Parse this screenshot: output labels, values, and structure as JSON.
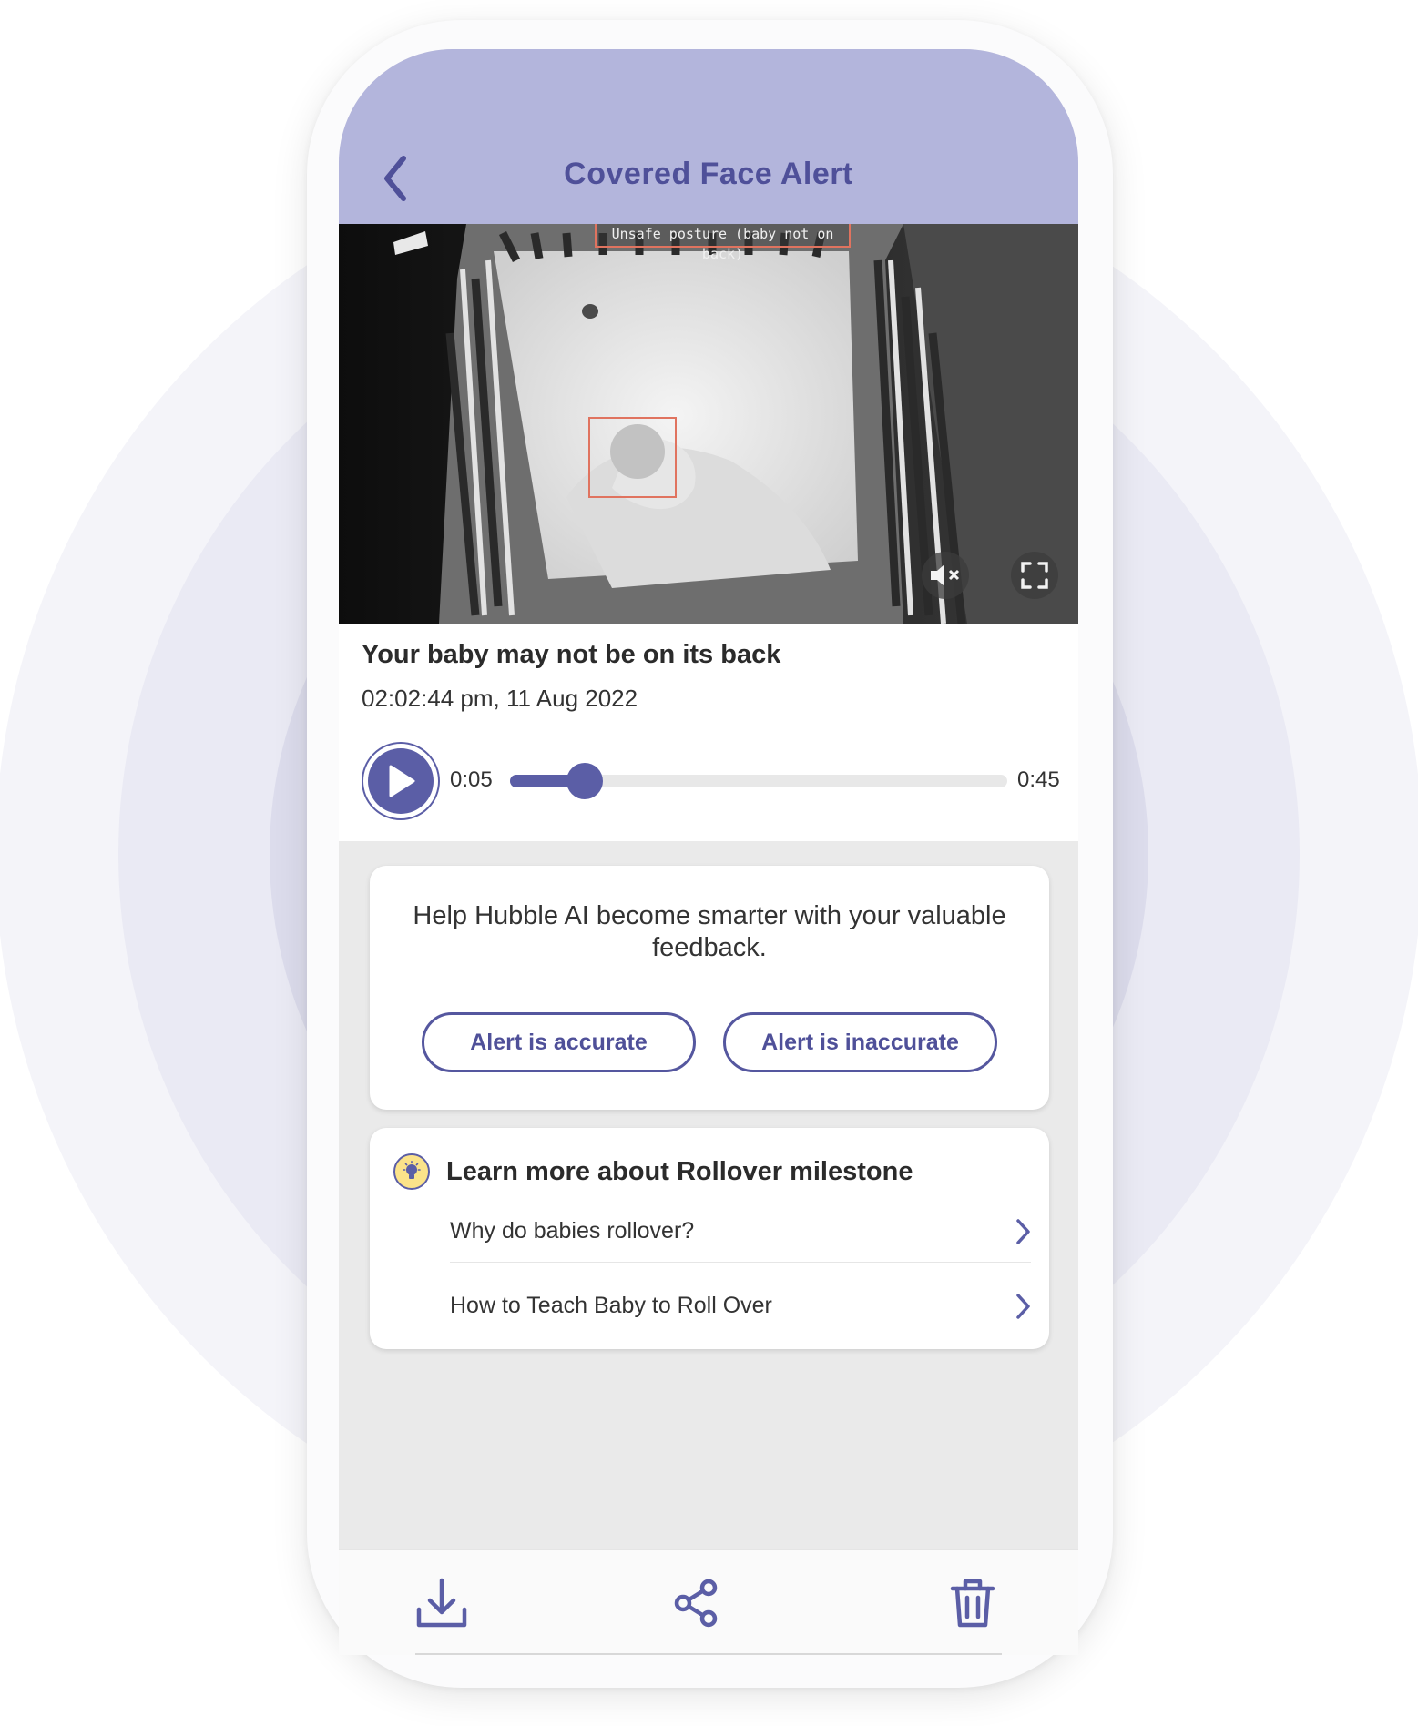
{
  "header": {
    "title": "Covered Face Alert",
    "background": "#b3b5dc",
    "accent": "#4f5099"
  },
  "video": {
    "posture_label": "Unsafe posture (baby not on back)",
    "detection_color": "#e0735f",
    "muted": true,
    "mute_icon": "speaker-muted-icon",
    "fullscreen_icon": "fullscreen-icon"
  },
  "event": {
    "headline": "Your baby may not be on its back",
    "timestamp": "02:02:44 pm, 11 Aug 2022"
  },
  "player": {
    "current_time": "0:05",
    "total_time": "0:45",
    "progress": 0.15,
    "play_icon": "play-icon"
  },
  "feedback": {
    "prompt": "Help Hubble AI become smarter with your valuable feedback.",
    "accurate_label": "Alert is accurate",
    "inaccurate_label": "Alert is inaccurate"
  },
  "learn": {
    "icon": "lightbulb-icon",
    "title": "Learn more about Rollover milestone",
    "links": [
      {
        "label": "Why do babies rollover?"
      },
      {
        "label": "How to Teach Baby to Roll Over"
      }
    ]
  },
  "toolbar": {
    "icons": [
      "download-icon",
      "share-icon",
      "trash-icon"
    ]
  }
}
